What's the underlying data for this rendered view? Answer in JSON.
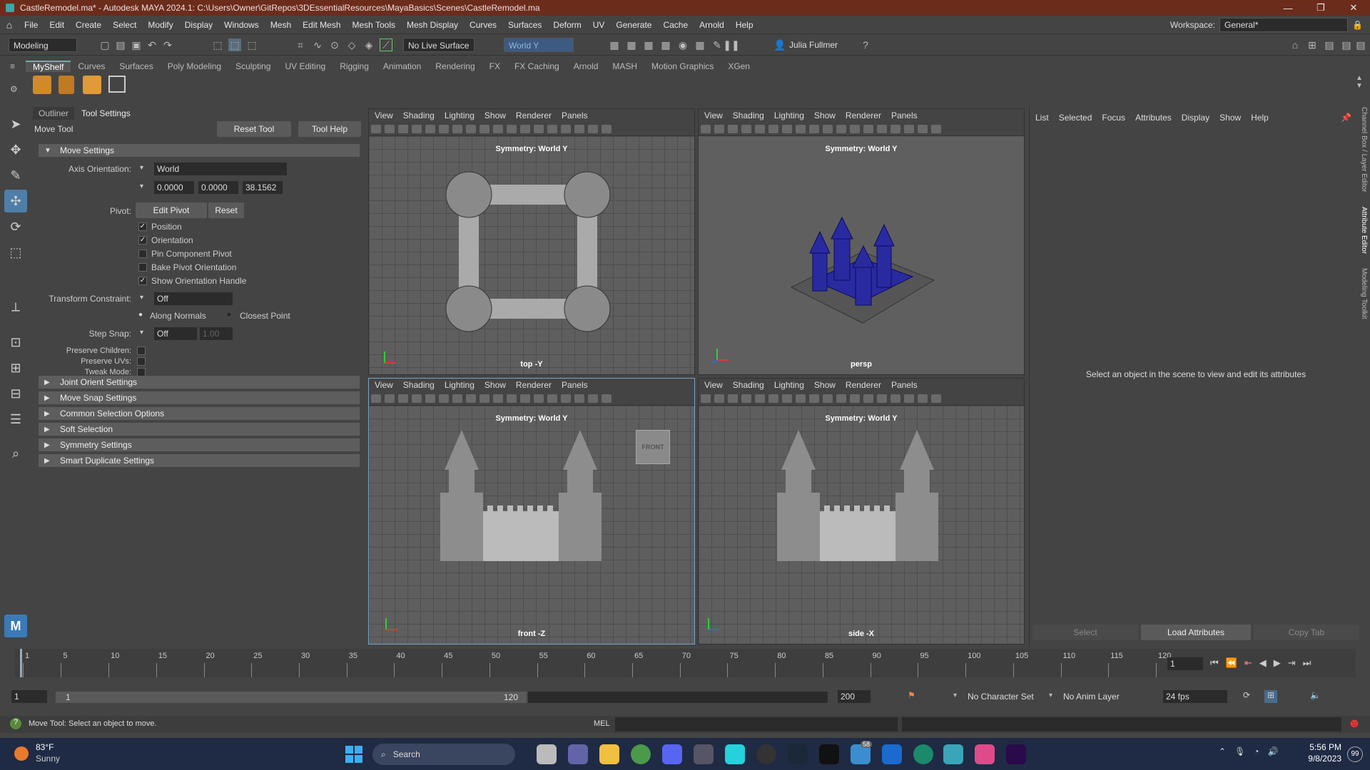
{
  "window": {
    "title": "CastleRemodel.ma* - Autodesk MAYA 2024.1: C:\\Users\\Owner\\GitRepos\\3DEssentialResources\\MayaBasics\\Scenes\\CastleRemodel.ma",
    "minimize": "—",
    "maximize": "❐",
    "close": "✕"
  },
  "menus": [
    "File",
    "Edit",
    "Create",
    "Select",
    "Modify",
    "Display",
    "Windows",
    "Mesh",
    "Edit Mesh",
    "Mesh Tools",
    "Mesh Display",
    "Curves",
    "Surfaces",
    "Deform",
    "UV",
    "Generate",
    "Cache",
    "Arnold",
    "Help"
  ],
  "workspace": {
    "label": "Workspace:",
    "value": "General*"
  },
  "statusline": {
    "mode": "Modeling",
    "live_surface": "No Live Surface",
    "symmetry": "World Y",
    "user": "Julia Fullmer"
  },
  "shelf_tabs": [
    "MyShelf",
    "Curves",
    "Surfaces",
    "Poly Modeling",
    "Sculpting",
    "UV Editing",
    "Rigging",
    "Animation",
    "Rendering",
    "FX",
    "FX Caching",
    "Arnold",
    "MASH",
    "Motion Graphics",
    "XGen"
  ],
  "left_panel": {
    "tabs": [
      "Outliner",
      "Tool Settings"
    ],
    "tool_name": "Move Tool",
    "reset_tool": "Reset Tool",
    "tool_help": "Tool Help",
    "move_settings": "Move Settings",
    "axis_orientation_label": "Axis Orientation:",
    "axis_orientation_value": "World",
    "vec": [
      "0.0000",
      "0.0000",
      "38.1562"
    ],
    "pivot_label": "Pivot:",
    "edit_pivot": "Edit Pivot",
    "reset": "Reset",
    "checks": [
      {
        "label": "Position",
        "checked": "✓"
      },
      {
        "label": "Orientation",
        "checked": "✓"
      },
      {
        "label": "Pin Component Pivot",
        "checked": ""
      },
      {
        "label": "Bake Pivot Orientation",
        "checked": ""
      },
      {
        "label": "Show Orientation Handle",
        "checked": "✓"
      }
    ],
    "transform_constraint_label": "Transform Constraint:",
    "transform_constraint_value": "Off",
    "along_normals": "Along Normals",
    "closest_point": "Closest Point",
    "step_snap_label": "Step Snap:",
    "step_snap_value": "Off",
    "step_snap_amount": "1.00",
    "preserve_children": "Preserve Children:",
    "preserve_uvs": "Preserve UVs:",
    "tweak_mode": "Tweak Mode:",
    "sections": [
      "Joint Orient Settings",
      "Move Snap Settings",
      "Common Selection Options",
      "Soft Selection",
      "Symmetry Settings",
      "Smart Duplicate Settings"
    ]
  },
  "viewport_menu": [
    "View",
    "Shading",
    "Lighting",
    "Show",
    "Renderer",
    "Panels"
  ],
  "viewports": {
    "symmetry": "Symmetry: World Y",
    "top": "top -Y",
    "persp": "persp",
    "front": "front -Z",
    "side": "side -X",
    "front_cube": "FRONT"
  },
  "right_panel": {
    "menu": [
      "List",
      "Selected",
      "Focus",
      "Attributes",
      "Display",
      "Show",
      "Help"
    ],
    "message": "Select an object in the scene to view and edit its attributes",
    "select": "Select",
    "load_attributes": "Load Attributes",
    "copy_tab": "Copy Tab"
  },
  "side_tabs": [
    "Channel Box / Layer Editor",
    "Attribute Editor",
    "Modeling Toolkit"
  ],
  "timeline": {
    "ticks": [
      "1",
      "5",
      "10",
      "15",
      "20",
      "25",
      "30",
      "35",
      "40",
      "45",
      "50",
      "55",
      "60",
      "65",
      "70",
      "75",
      "80",
      "85",
      "90",
      "95",
      "100",
      "105",
      "110",
      "115",
      "120"
    ],
    "current_frame": "1"
  },
  "range": {
    "start": "1",
    "inner_start": "1",
    "inner_end": "120",
    "end": "200",
    "character_set": "No Character Set",
    "anim_layer": "No Anim Layer",
    "fps": "24 fps"
  },
  "helpline": {
    "text": "Move Tool: Select an object to move.",
    "mel": "MEL"
  },
  "taskbar": {
    "temp": "83°F",
    "weather": "Sunny",
    "search": "Search",
    "time": "5:56 PM",
    "date": "9/8/2023",
    "badge1": "58",
    "badge2": "99"
  }
}
